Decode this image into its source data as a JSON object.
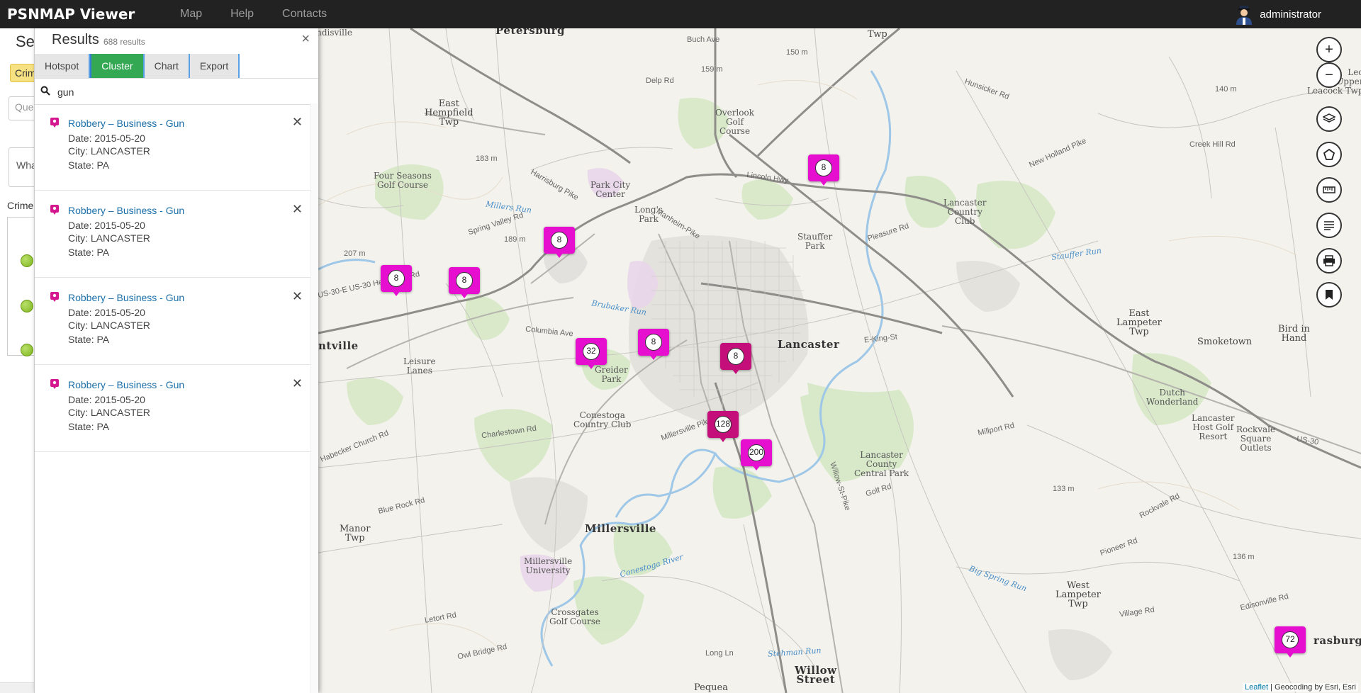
{
  "app": {
    "title": "PSNMAP Viewer",
    "user": "administrator"
  },
  "nav": {
    "items": [
      "Map",
      "Help",
      "Contacts"
    ]
  },
  "search_panel": {
    "title": "Sea",
    "crime_button": "Crim",
    "query_placeholder": "Quer",
    "what_text": "Wha",
    "crime_label": "Crime"
  },
  "results": {
    "title": "Results",
    "count": "688",
    "count_suffix": "results",
    "close": "×",
    "tabs": [
      {
        "label": "Hotspot",
        "active": false
      },
      {
        "label": "Cluster",
        "active": true
      },
      {
        "label": "Chart",
        "active": false
      },
      {
        "label": "Export",
        "active": false
      }
    ],
    "filter_value": "gun",
    "items": [
      {
        "title": "Robbery – Business - Gun",
        "date": "Date: 2015-05-20",
        "city": "City: LANCASTER",
        "state": "State: PA"
      },
      {
        "title": "Robbery – Business - Gun",
        "date": "Date: 2015-05-20",
        "city": "City: LANCASTER",
        "state": "State: PA"
      },
      {
        "title": "Robbery – Business - Gun",
        "date": "Date: 2015-05-20",
        "city": "City: LANCASTER",
        "state": "State: PA"
      },
      {
        "title": "Robbery – Business - Gun",
        "date": "Date: 2015-05-20",
        "city": "City: LANCASTER",
        "state": "State: PA"
      }
    ]
  },
  "map": {
    "clusters": [
      "8",
      "8",
      "8",
      "8",
      "32",
      "8",
      "8",
      "128",
      "200",
      "72"
    ],
    "labels": {
      "petersburg": "Petersburg",
      "landisville": "Landisville",
      "east_hempfield": "East\nHempfield\nTwp",
      "four_seasons": "Four Seasons\nGolf Course",
      "park_city": "Park City\nCenter",
      "longs_park": "Long's\nPark",
      "overlook": "Overlook\nGolf\nCourse",
      "stauffer_park": "Stauffer\nPark",
      "lancaster_cc": "Lancaster\nCountry\nClub",
      "lancaster": "Lancaster",
      "leisure_lanes": "Leisure\nLanes",
      "greider_park": "Greider\nPark",
      "conestoga_cc": "Conestoga\nCountry Club",
      "lancaster_central_park": "Lancaster\nCounty\nCentral Park",
      "millersville": "Millersville",
      "millersville_univ": "Millersville\nUniversity",
      "crossgates": "Crossgates\nGolf Course",
      "manor_twp": "Manor\nTwp",
      "willow_street": "Willow\nStreet",
      "pequea": "Pequea",
      "west_lampeter": "West\nLampeter\nTwp",
      "east_lampeter": "East\nLampeter\nTwp",
      "smoketown": "Smoketown",
      "bird_in_hand": "Bird in\nHand",
      "dutch_wonderland": "Dutch\nWonderland",
      "lancaster_host": "Lancaster\nHost Golf\nResort",
      "rockvale": "Rockvale\nSquare\nOutlets",
      "strasburg": "rasburg",
      "leacock": "Leo\nUpper\nLeacock Twp",
      "ntville": "ntville",
      "twp_top": "Twp",
      "lincoln_hwy": "Lincoln Hwy",
      "us30": "US-30",
      "hempland": "US-30-E US-30  Hempland Rd",
      "columbia_ave": "Columbia Ave",
      "harrisburg_pike": "Harrisburg Pike",
      "spring_valley": "Spring Valley Rd",
      "manheim_pike": "Manheim-Pike",
      "millersville_pike": "Millersville Pike",
      "willow_st_pike": "Willow-St-Pike",
      "e_king": "E-King-St",
      "charlestown": "Charlestown Rd",
      "blue_rock": "Blue Rock Rd",
      "habecker": "Habecker Church Rd",
      "brubaker_run": "Brubaker Run",
      "conestoga_river": "Conestoga River",
      "millers_run": "Millers Run",
      "stauffer_run": "Stauffer Run",
      "big_spring_run": "Big Spring Run",
      "stehman_run": "Stehman Run",
      "pleasure_rd": "Pleasure Rd",
      "creek_hill": "Creek Hill Rd",
      "new_holland": "New Holland Pike",
      "hunsicker": "Hunsicker Rd",
      "buch_ave": "Buch Ave",
      "delp_rd": "Delp Rd",
      "millport": "Millport Rd",
      "rockvale_rd": "Rockvale Rd",
      "golf_rd": "Golf Rd",
      "pioneer": "Pioneer Rd",
      "edisonville": "Edisonville Rd",
      "village_rd": "Village Rd",
      "long_ln": "Long Ln",
      "letort": "Letort Rd",
      "owl_bridge": "Owl Bridge Rd",
      "rd_150": "150 m",
      "rd_159": "159 m",
      "rd_183": "183 m",
      "rd_189": "189 m",
      "rd_207": "207 m",
      "rd_133": "133 m",
      "rd_136": "136 m",
      "rd_140": "140 m"
    },
    "attribution_link": "Leaflet",
    "attribution_text": " | Geocoding by Esri, Esri"
  }
}
